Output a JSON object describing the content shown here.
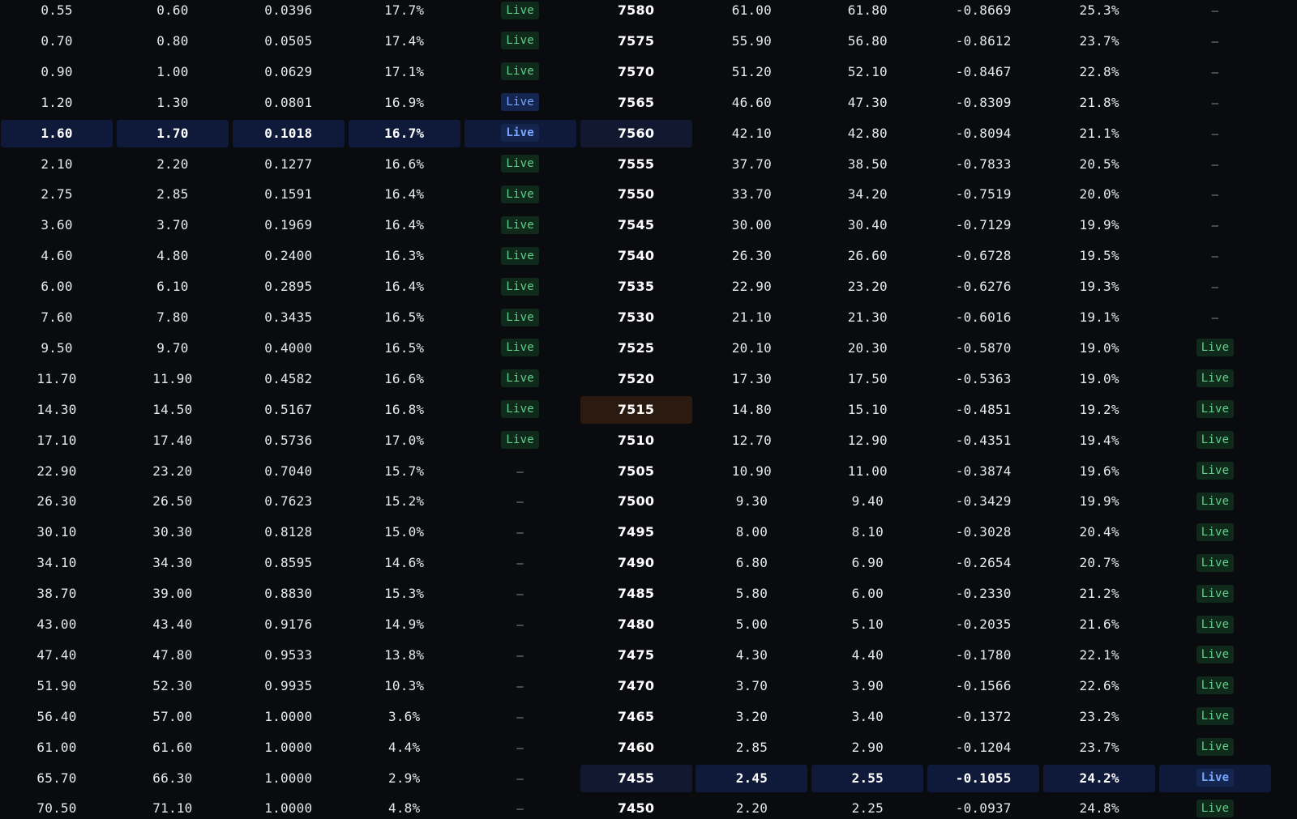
{
  "status": {
    "live": "Live",
    "dash": "–"
  },
  "rows": [
    {
      "call": {
        "bid": "0.55",
        "ask": "0.60",
        "delta": "0.0396",
        "iv": "17.7%",
        "status": "Live"
      },
      "strike": "7580",
      "put": {
        "bid": "61.00",
        "ask": "61.80",
        "delta": "-0.8669",
        "iv": "25.3%",
        "status": "–"
      }
    },
    {
      "call": {
        "bid": "0.70",
        "ask": "0.80",
        "delta": "0.0505",
        "iv": "17.4%",
        "status": "Live"
      },
      "strike": "7575",
      "put": {
        "bid": "55.90",
        "ask": "56.80",
        "delta": "-0.8612",
        "iv": "23.7%",
        "status": "–"
      }
    },
    {
      "call": {
        "bid": "0.90",
        "ask": "1.00",
        "delta": "0.0629",
        "iv": "17.1%",
        "status": "Live"
      },
      "strike": "7570",
      "put": {
        "bid": "51.20",
        "ask": "52.10",
        "delta": "-0.8467",
        "iv": "22.8%",
        "status": "–"
      }
    },
    {
      "call": {
        "bid": "1.20",
        "ask": "1.30",
        "delta": "0.0801",
        "iv": "16.9%",
        "status": "Live"
      },
      "strike": "7565",
      "put": {
        "bid": "46.60",
        "ask": "47.30",
        "delta": "-0.8309",
        "iv": "21.8%",
        "status": "–"
      }
    },
    {
      "call": {
        "bid": "1.60",
        "ask": "1.70",
        "delta": "0.1018",
        "iv": "16.7%",
        "status": "Live"
      },
      "strike": "7560",
      "put": {
        "bid": "42.10",
        "ask": "42.80",
        "delta": "-0.8094",
        "iv": "21.1%",
        "status": "–"
      },
      "highlight": "call"
    },
    {
      "call": {
        "bid": "2.10",
        "ask": "2.20",
        "delta": "0.1277",
        "iv": "16.6%",
        "status": "Live"
      },
      "strike": "7555",
      "put": {
        "bid": "37.70",
        "ask": "38.50",
        "delta": "-0.7833",
        "iv": "20.5%",
        "status": "–"
      }
    },
    {
      "call": {
        "bid": "2.75",
        "ask": "2.85",
        "delta": "0.1591",
        "iv": "16.4%",
        "status": "Live"
      },
      "strike": "7550",
      "put": {
        "bid": "33.70",
        "ask": "34.20",
        "delta": "-0.7519",
        "iv": "20.0%",
        "status": "–"
      }
    },
    {
      "call": {
        "bid": "3.60",
        "ask": "3.70",
        "delta": "0.1969",
        "iv": "16.4%",
        "status": "Live"
      },
      "strike": "7545",
      "put": {
        "bid": "30.00",
        "ask": "30.40",
        "delta": "-0.7129",
        "iv": "19.9%",
        "status": "–"
      }
    },
    {
      "call": {
        "bid": "4.60",
        "ask": "4.80",
        "delta": "0.2400",
        "iv": "16.3%",
        "status": "Live"
      },
      "strike": "7540",
      "put": {
        "bid": "26.30",
        "ask": "26.60",
        "delta": "-0.6728",
        "iv": "19.5%",
        "status": "–"
      }
    },
    {
      "call": {
        "bid": "6.00",
        "ask": "6.10",
        "delta": "0.2895",
        "iv": "16.4%",
        "status": "Live"
      },
      "strike": "7535",
      "put": {
        "bid": "22.90",
        "ask": "23.20",
        "delta": "-0.6276",
        "iv": "19.3%",
        "status": "–"
      }
    },
    {
      "call": {
        "bid": "7.60",
        "ask": "7.80",
        "delta": "0.3435",
        "iv": "16.5%",
        "status": "Live"
      },
      "strike": "7530",
      "put": {
        "bid": "21.10",
        "ask": "21.30",
        "delta": "-0.6016",
        "iv": "19.1%",
        "status": "–"
      }
    },
    {
      "call": {
        "bid": "9.50",
        "ask": "9.70",
        "delta": "0.4000",
        "iv": "16.5%",
        "status": "Live"
      },
      "strike": "7525",
      "put": {
        "bid": "20.10",
        "ask": "20.30",
        "delta": "-0.5870",
        "iv": "19.0%",
        "status": "Live"
      }
    },
    {
      "call": {
        "bid": "11.70",
        "ask": "11.90",
        "delta": "0.4582",
        "iv": "16.6%",
        "status": "Live"
      },
      "strike": "7520",
      "put": {
        "bid": "17.30",
        "ask": "17.50",
        "delta": "-0.5363",
        "iv": "19.0%",
        "status": "Live"
      }
    },
    {
      "call": {
        "bid": "14.30",
        "ask": "14.50",
        "delta": "0.5167",
        "iv": "16.8%",
        "status": "Live"
      },
      "strike": "7515",
      "put": {
        "bid": "14.80",
        "ask": "15.10",
        "delta": "-0.4851",
        "iv": "19.2%",
        "status": "Live"
      },
      "atm": true
    },
    {
      "call": {
        "bid": "17.10",
        "ask": "17.40",
        "delta": "0.5736",
        "iv": "17.0%",
        "status": "Live"
      },
      "strike": "7510",
      "put": {
        "bid": "12.70",
        "ask": "12.90",
        "delta": "-0.4351",
        "iv": "19.4%",
        "status": "Live"
      }
    },
    {
      "call": {
        "bid": "22.90",
        "ask": "23.20",
        "delta": "0.7040",
        "iv": "15.7%",
        "status": "–"
      },
      "strike": "7505",
      "put": {
        "bid": "10.90",
        "ask": "11.00",
        "delta": "-0.3874",
        "iv": "19.6%",
        "status": "Live"
      }
    },
    {
      "call": {
        "bid": "26.30",
        "ask": "26.50",
        "delta": "0.7623",
        "iv": "15.2%",
        "status": "–"
      },
      "strike": "7500",
      "put": {
        "bid": "9.30",
        "ask": "9.40",
        "delta": "-0.3429",
        "iv": "19.9%",
        "status": "Live"
      }
    },
    {
      "call": {
        "bid": "30.10",
        "ask": "30.30",
        "delta": "0.8128",
        "iv": "15.0%",
        "status": "–"
      },
      "strike": "7495",
      "put": {
        "bid": "8.00",
        "ask": "8.10",
        "delta": "-0.3028",
        "iv": "20.4%",
        "status": "Live"
      }
    },
    {
      "call": {
        "bid": "34.10",
        "ask": "34.30",
        "delta": "0.8595",
        "iv": "14.6%",
        "status": "–"
      },
      "strike": "7490",
      "put": {
        "bid": "6.80",
        "ask": "6.90",
        "delta": "-0.2654",
        "iv": "20.7%",
        "status": "Live"
      }
    },
    {
      "call": {
        "bid": "38.70",
        "ask": "39.00",
        "delta": "0.8830",
        "iv": "15.3%",
        "status": "–"
      },
      "strike": "7485",
      "put": {
        "bid": "5.80",
        "ask": "6.00",
        "delta": "-0.2330",
        "iv": "21.2%",
        "status": "Live"
      }
    },
    {
      "call": {
        "bid": "43.00",
        "ask": "43.40",
        "delta": "0.9176",
        "iv": "14.9%",
        "status": "–"
      },
      "strike": "7480",
      "put": {
        "bid": "5.00",
        "ask": "5.10",
        "delta": "-0.2035",
        "iv": "21.6%",
        "status": "Live"
      }
    },
    {
      "call": {
        "bid": "47.40",
        "ask": "47.80",
        "delta": "0.9533",
        "iv": "13.8%",
        "status": "–"
      },
      "strike": "7475",
      "put": {
        "bid": "4.30",
        "ask": "4.40",
        "delta": "-0.1780",
        "iv": "22.1%",
        "status": "Live"
      }
    },
    {
      "call": {
        "bid": "51.90",
        "ask": "52.30",
        "delta": "0.9935",
        "iv": "10.3%",
        "status": "–"
      },
      "strike": "7470",
      "put": {
        "bid": "3.70",
        "ask": "3.90",
        "delta": "-0.1566",
        "iv": "22.6%",
        "status": "Live"
      }
    },
    {
      "call": {
        "bid": "56.40",
        "ask": "57.00",
        "delta": "1.0000",
        "iv": "3.6%",
        "status": "–"
      },
      "strike": "7465",
      "put": {
        "bid": "3.20",
        "ask": "3.40",
        "delta": "-0.1372",
        "iv": "23.2%",
        "status": "Live"
      }
    },
    {
      "call": {
        "bid": "61.00",
        "ask": "61.60",
        "delta": "1.0000",
        "iv": "4.4%",
        "status": "–"
      },
      "strike": "7460",
      "put": {
        "bid": "2.85",
        "ask": "2.90",
        "delta": "-0.1204",
        "iv": "23.7%",
        "status": "Live"
      }
    },
    {
      "call": {
        "bid": "65.70",
        "ask": "66.30",
        "delta": "1.0000",
        "iv": "2.9%",
        "status": "–"
      },
      "strike": "7455",
      "put": {
        "bid": "2.45",
        "ask": "2.55",
        "delta": "-0.1055",
        "iv": "24.2%",
        "status": "Live"
      },
      "highlight": "put"
    },
    {
      "call": {
        "bid": "70.50",
        "ask": "71.10",
        "delta": "1.0000",
        "iv": "4.8%",
        "status": "–"
      },
      "strike": "7450",
      "put": {
        "bid": "2.20",
        "ask": "2.25",
        "delta": "-0.0937",
        "iv": "24.8%",
        "status": "Live"
      }
    }
  ]
}
